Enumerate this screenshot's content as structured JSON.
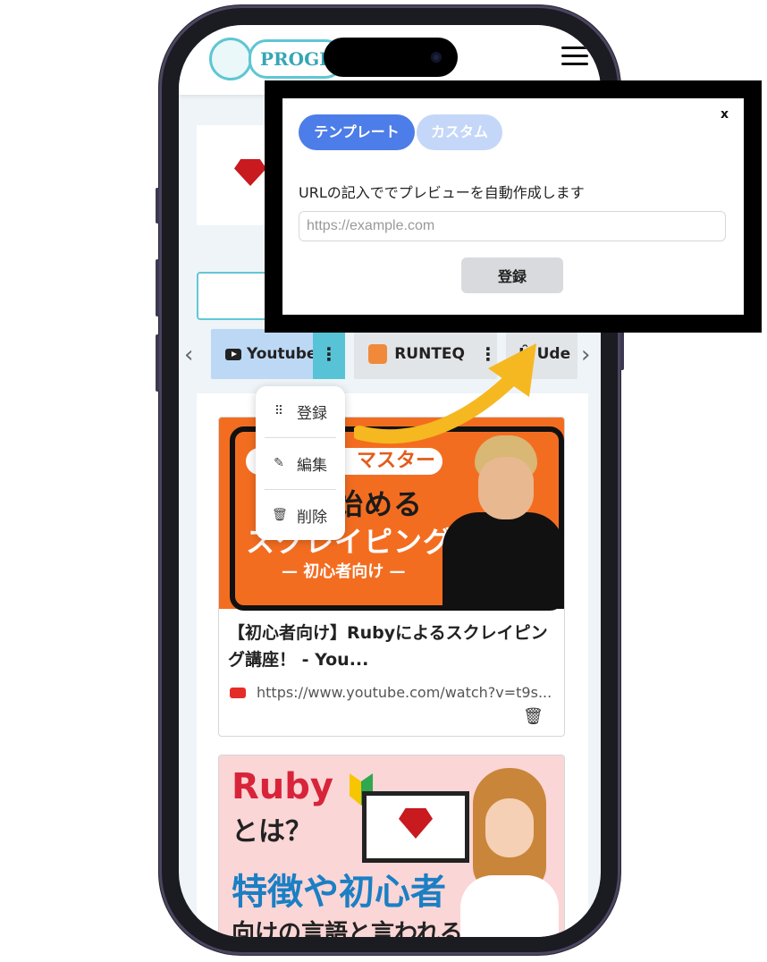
{
  "header": {
    "logo_text": "PROGL",
    "menu_icon": "hamburger-icon"
  },
  "tabs": {
    "prev_icon": "chevron-left-icon",
    "next_icon": "chevron-right-icon",
    "items": [
      {
        "label": "Youtube",
        "icon": "youtube-icon",
        "active": true
      },
      {
        "label": "RUNTEQ",
        "icon": "runteq-icon",
        "active": false
      },
      {
        "label": "Ude",
        "icon": "udemy-icon",
        "active": false
      }
    ]
  },
  "dropdown": {
    "items": [
      {
        "label": "登録",
        "icon": "grid-icon"
      },
      {
        "label": "編集",
        "icon": "pencil-icon"
      },
      {
        "label": "削除",
        "icon": "trash-icon"
      }
    ]
  },
  "cards": [
    {
      "thumb_pill": "マスター",
      "thumb_line1": "　　で始める",
      "thumb_line2": "スクレイピング",
      "thumb_sub": "— 初心者向け —",
      "title": "【初心者向け】Rubyによるスクレイピング講座！ - You...",
      "url": "https://www.youtube.com/watch?v=t9s..."
    },
    {
      "thumb_title": "Ruby",
      "thumb_line1": "とは？",
      "thumb_line2": "特徴や初心者",
      "thumb_line3": "向けの言語と言われる"
    }
  ],
  "modal": {
    "close_label": "x",
    "tab_template": "テンプレート",
    "tab_custom": "カスタム",
    "label": "URLの記入ででプレビューを自動作成します",
    "input_value": "",
    "input_placeholder": "https://example.com",
    "submit_label": "登録"
  },
  "colors": {
    "accent": "#4d7de8",
    "accent_light": "#c4d7f8",
    "teal": "#58c3d6",
    "arrow": "#f5b820"
  }
}
